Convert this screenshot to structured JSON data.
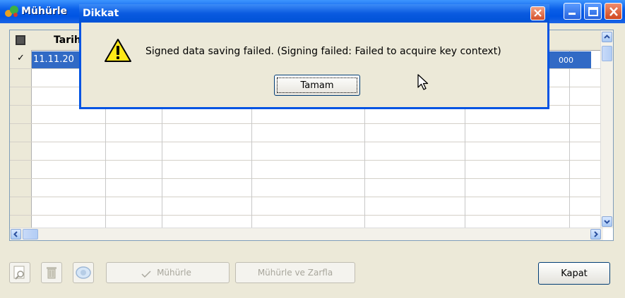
{
  "window": {
    "title": "Mühürle"
  },
  "grid": {
    "header_col_1": "Tarih",
    "selected_row": {
      "marker": "✓",
      "date": "11.11.20",
      "value": "000"
    }
  },
  "toolbar": {
    "muhurle_label": "Mühürle",
    "muhurle_zarfla_label": "Mühürle ve Zarfla",
    "kapat_label": "Kapat"
  },
  "dialog": {
    "title": "Dikkat",
    "message": "Signed data saving failed. (Signing failed: Failed to acquire key context)",
    "ok_label": "Tamam"
  },
  "icons": [
    "app-icon",
    "minimize-icon",
    "maximize-icon",
    "close-icon",
    "warning-icon",
    "search-icon",
    "trash-icon",
    "view-icon",
    "check-icon",
    "mouse-cursor-icon"
  ],
  "colors": {
    "titlebar": "#0054e3",
    "selection": "#316ac5",
    "window_bg": "#ece9d8",
    "close_button": "#d4502a"
  }
}
